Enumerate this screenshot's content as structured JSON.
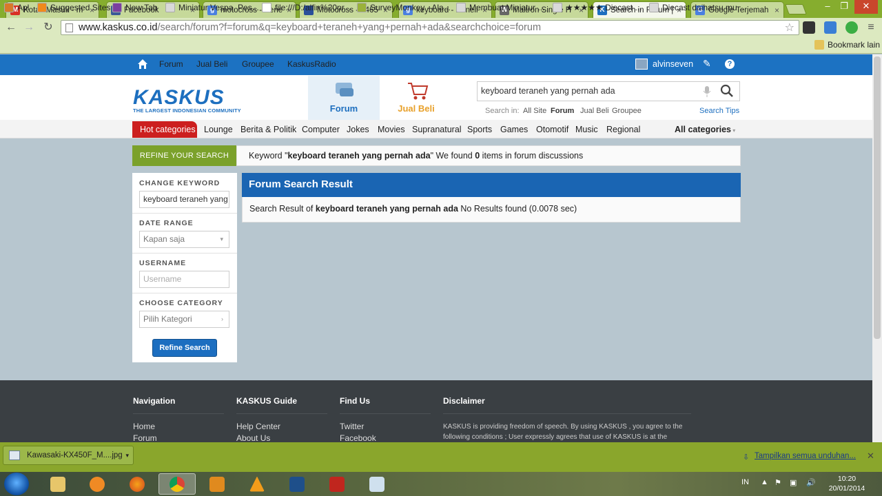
{
  "browser": {
    "tabs": [
      {
        "label": "Kotak Masuk - m",
        "fav_color": "#d93025",
        "fav_glyph": "M"
      },
      {
        "label": "Facebook",
        "fav_color": "#3b5998",
        "fav_glyph": "f"
      },
      {
        "label": "motocross - Pene",
        "fav_color": "#4a7fe0",
        "fav_glyph": "g"
      },
      {
        "label": "Motocross - 1465",
        "fav_color": "#2a4f9a",
        "fav_glyph": ""
      },
      {
        "label": "keyboard - Peneli",
        "fav_color": "#4a7fe0",
        "fav_glyph": "g"
      },
      {
        "label": "Maltron Single H",
        "fav_color": "#666666",
        "fav_glyph": "W"
      },
      {
        "label": "Search in Forum |",
        "fav_color": "#1d6fbf",
        "fav_glyph": "K"
      },
      {
        "label": "Google Terjemah",
        "fav_color": "#4a7fe0",
        "fav_glyph": "G"
      }
    ],
    "active_tab": 6,
    "url_host": "www.kaskus.co.id",
    "url_rest": "/search/forum?f=forum&q=keyboard+teraneh+yang+pernah+ada&searchchoice=forum",
    "bookmarks": [
      {
        "label": "Apl",
        "color": "#d87a2a"
      },
      {
        "label": "Suggested Sites",
        "color": "#f08a1c"
      },
      {
        "label": "New Tab",
        "color": "#7b3fa0"
      },
      {
        "label": "Miniatur Vespa, Pes...",
        "color": "#d9d9d9"
      },
      {
        "label": "file:///D:/alfin%20pr...",
        "color": "#ffffff"
      },
      {
        "label": "SurveyMonkey - Ala...",
        "color": "#9ab23a"
      },
      {
        "label": "Membuat Miniatur ...",
        "color": "#d9d9d9"
      },
      {
        "label": "★★★★★ Diecast ...",
        "color": "#d9d9d9"
      },
      {
        "label": "Diecast daihatsu mu...",
        "color": "#d9d9d9"
      }
    ],
    "bookmark_other": "Bookmark lain"
  },
  "kaskus": {
    "topnav": [
      "Forum",
      "Jual Beli",
      "Groupee",
      "KaskusRadio"
    ],
    "username": "alvinseven",
    "logo_text": "KASKUS",
    "logo_tagline": "THE LARGEST INDONESIAN COMMUNITY",
    "header_forum": "Forum",
    "header_jualbeli": "Jual Beli",
    "search_value": "keyboard teraneh yang pernah ada",
    "search_in_label": "Search in:",
    "search_in": [
      "All Site",
      "Forum",
      "Jual Beli",
      "Groupee"
    ],
    "search_tips": "Search Tips",
    "hot_categories": "Hot categories",
    "categories": [
      "Lounge",
      "Berita & Politik",
      "Computer",
      "Jokes",
      "Movies",
      "Supranatural",
      "Sports",
      "Games",
      "Otomotif",
      "Music",
      "Regional"
    ],
    "all_categories": "All categories",
    "refine_title": "REFINE YOUR SEARCH",
    "keyword_prefix": "Keyword \"",
    "keyword": "keyboard teraneh yang pernah ada",
    "keyword_mid": "\" We found ",
    "found_count": "0",
    "keyword_suffix": " items in forum discussions",
    "sidebar": {
      "change_keyword_label": "CHANGE KEYWORD",
      "change_keyword_value": "keyboard teraneh yang pernah ada",
      "date_range_label": "DATE RANGE",
      "date_range_value": "Kapan saja",
      "username_label": "USERNAME",
      "username_placeholder": "Username",
      "category_label": "CHOOSE CATEGORY",
      "category_value": "Pilih Kategori",
      "refine_button": "Refine Search"
    },
    "result_title": "Forum Search Result",
    "result_prefix": "Search Result of ",
    "result_keyword": "keyboard teraneh yang pernah ada",
    "result_suffix": " No Results found (0.0078 sec)"
  },
  "footer": {
    "columns": [
      {
        "title": "Navigation",
        "links": [
          "Home",
          "Forum"
        ]
      },
      {
        "title": "KASKUS Guide",
        "links": [
          "Help Center",
          "About Us"
        ]
      },
      {
        "title": "Find Us",
        "links": [
          "Twitter",
          "Facebook"
        ]
      }
    ],
    "disclaimer_title": "Disclaimer",
    "disclaimer_text": "KASKUS is providing freedom of speech. By using KASKUS , you agree to the following conditions ; User expressly agrees that use of KASKUS is at the"
  },
  "downloads": {
    "file": "Kawasaki-KX450F_M....jpg",
    "show_all": "Tampilkan semua unduhan..."
  },
  "taskbar": {
    "lang": "IN",
    "time": "10:20",
    "date": "20/01/2014"
  }
}
